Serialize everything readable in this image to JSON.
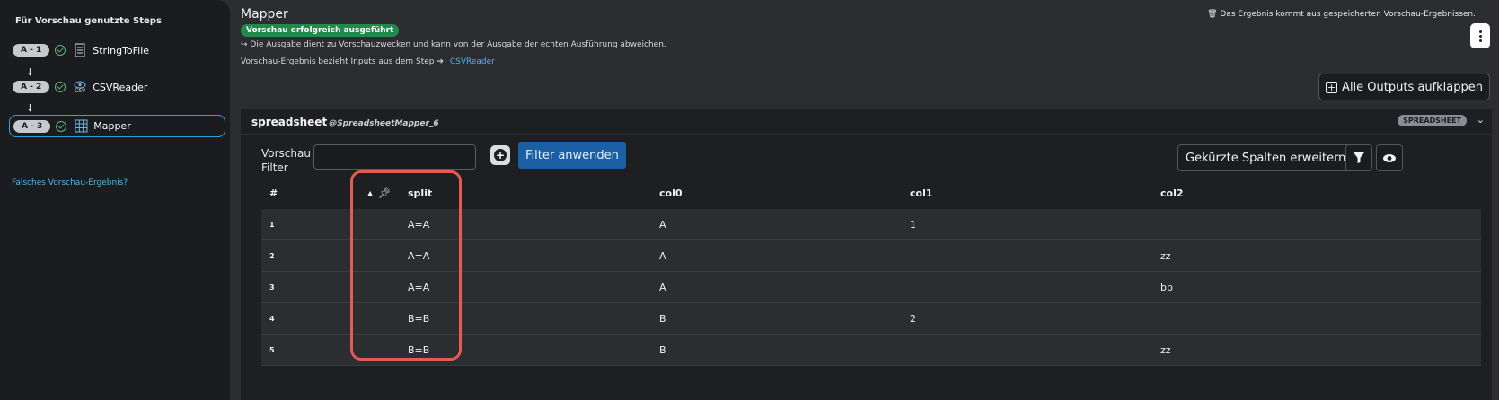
{
  "sidebar": {
    "title": "Für Vorschau genutzte Steps",
    "steps": [
      {
        "badge": "A - 1",
        "label": "StringToFile",
        "icon": "file-lines-icon"
      },
      {
        "badge": "A - 2",
        "label": "CSVReader",
        "icon": "eye-csv-icon",
        "icon_text": "CSV"
      },
      {
        "badge": "A - 3",
        "label": "Mapper",
        "icon": "table-icon"
      }
    ],
    "arrow": "🠗",
    "link": "Falsches Vorschau-Ergebnis?"
  },
  "header": {
    "title": "Mapper",
    "status_badge": "Vorschau erfolgreich ausgeführt",
    "info_line1": "↪ Die Ausgabe dient zu Vorschauzwecken und kann von der Ausgabe der echten Ausführung abweichen.",
    "info_line2": "Vorschau-Ergebnis bezieht Inputs aus dem Step",
    "info_line2_arrow": "➔",
    "info_line2_link": "CSVReader",
    "cached_note": "🗑 Das Ergebnis kommt aus gespeicherten Vorschau-Ergebnissen.",
    "expand_all_label": "Alle Outputs aufklappen"
  },
  "panel": {
    "title": "spreadsheet",
    "subtitle": "@SpreadsheetMapper_6",
    "type_badge": "SPREADSHEET",
    "filter_label_line1": "Vorschau",
    "filter_label_line2": "Filter",
    "filter_value": "",
    "apply_filter_label": "Filter anwenden",
    "expand_columns_label": "Gekürzte Spalten erweitern"
  },
  "table": {
    "columns": [
      "#",
      "split",
      "col0",
      "col1",
      "col2"
    ],
    "rows": [
      {
        "idx": "1",
        "split": "A=A",
        "col0": "A",
        "col1": "1",
        "col2": ""
      },
      {
        "idx": "2",
        "split": "A=A",
        "col0": "A",
        "col1": "",
        "col2": "zz"
      },
      {
        "idx": "3",
        "split": "A=A",
        "col0": "A",
        "col1": "",
        "col2": "bb"
      },
      {
        "idx": "4",
        "split": "B=B",
        "col0": "B",
        "col1": "2",
        "col2": ""
      },
      {
        "idx": "5",
        "split": "B=B",
        "col0": "B",
        "col1": "",
        "col2": "zz"
      }
    ]
  },
  "colors": {
    "accent": "#1a5fa5",
    "success": "#1f8a4c",
    "link": "#4fb4e6",
    "highlight": "#e25c52"
  }
}
